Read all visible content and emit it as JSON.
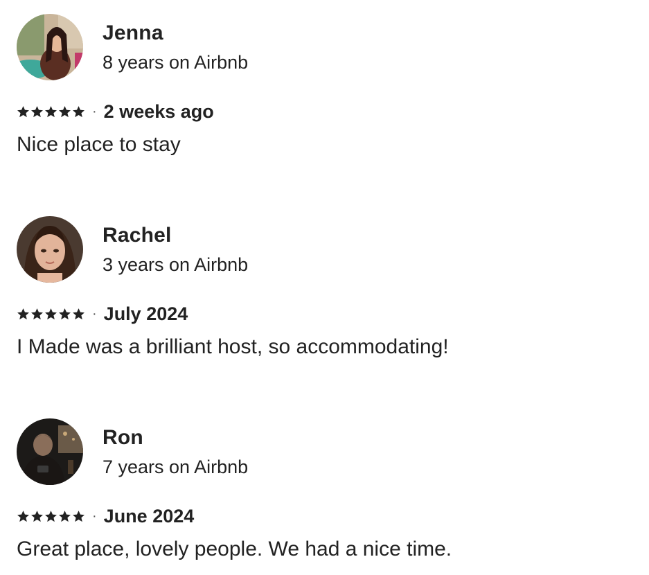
{
  "reviews": [
    {
      "name": "Jenna",
      "tenure": "8 years on Airbnb",
      "rating": 5,
      "date": "2 weeks ago",
      "text": "Nice place to stay",
      "avatar_icon": "avatar-photo-icon"
    },
    {
      "name": "Rachel",
      "tenure": "3 years on Airbnb",
      "rating": 5,
      "date": "July 2024",
      "text": "I Made was a brilliant host, so accommodating!",
      "avatar_icon": "avatar-photo-icon"
    },
    {
      "name": "Ron",
      "tenure": "7 years on Airbnb",
      "rating": 5,
      "date": "June 2024",
      "text": "Great place, lovely people. We had a nice time.",
      "avatar_icon": "avatar-photo-icon"
    }
  ],
  "separator": "·",
  "colors": {
    "text": "#222222",
    "star": "#222222",
    "background": "#ffffff"
  }
}
